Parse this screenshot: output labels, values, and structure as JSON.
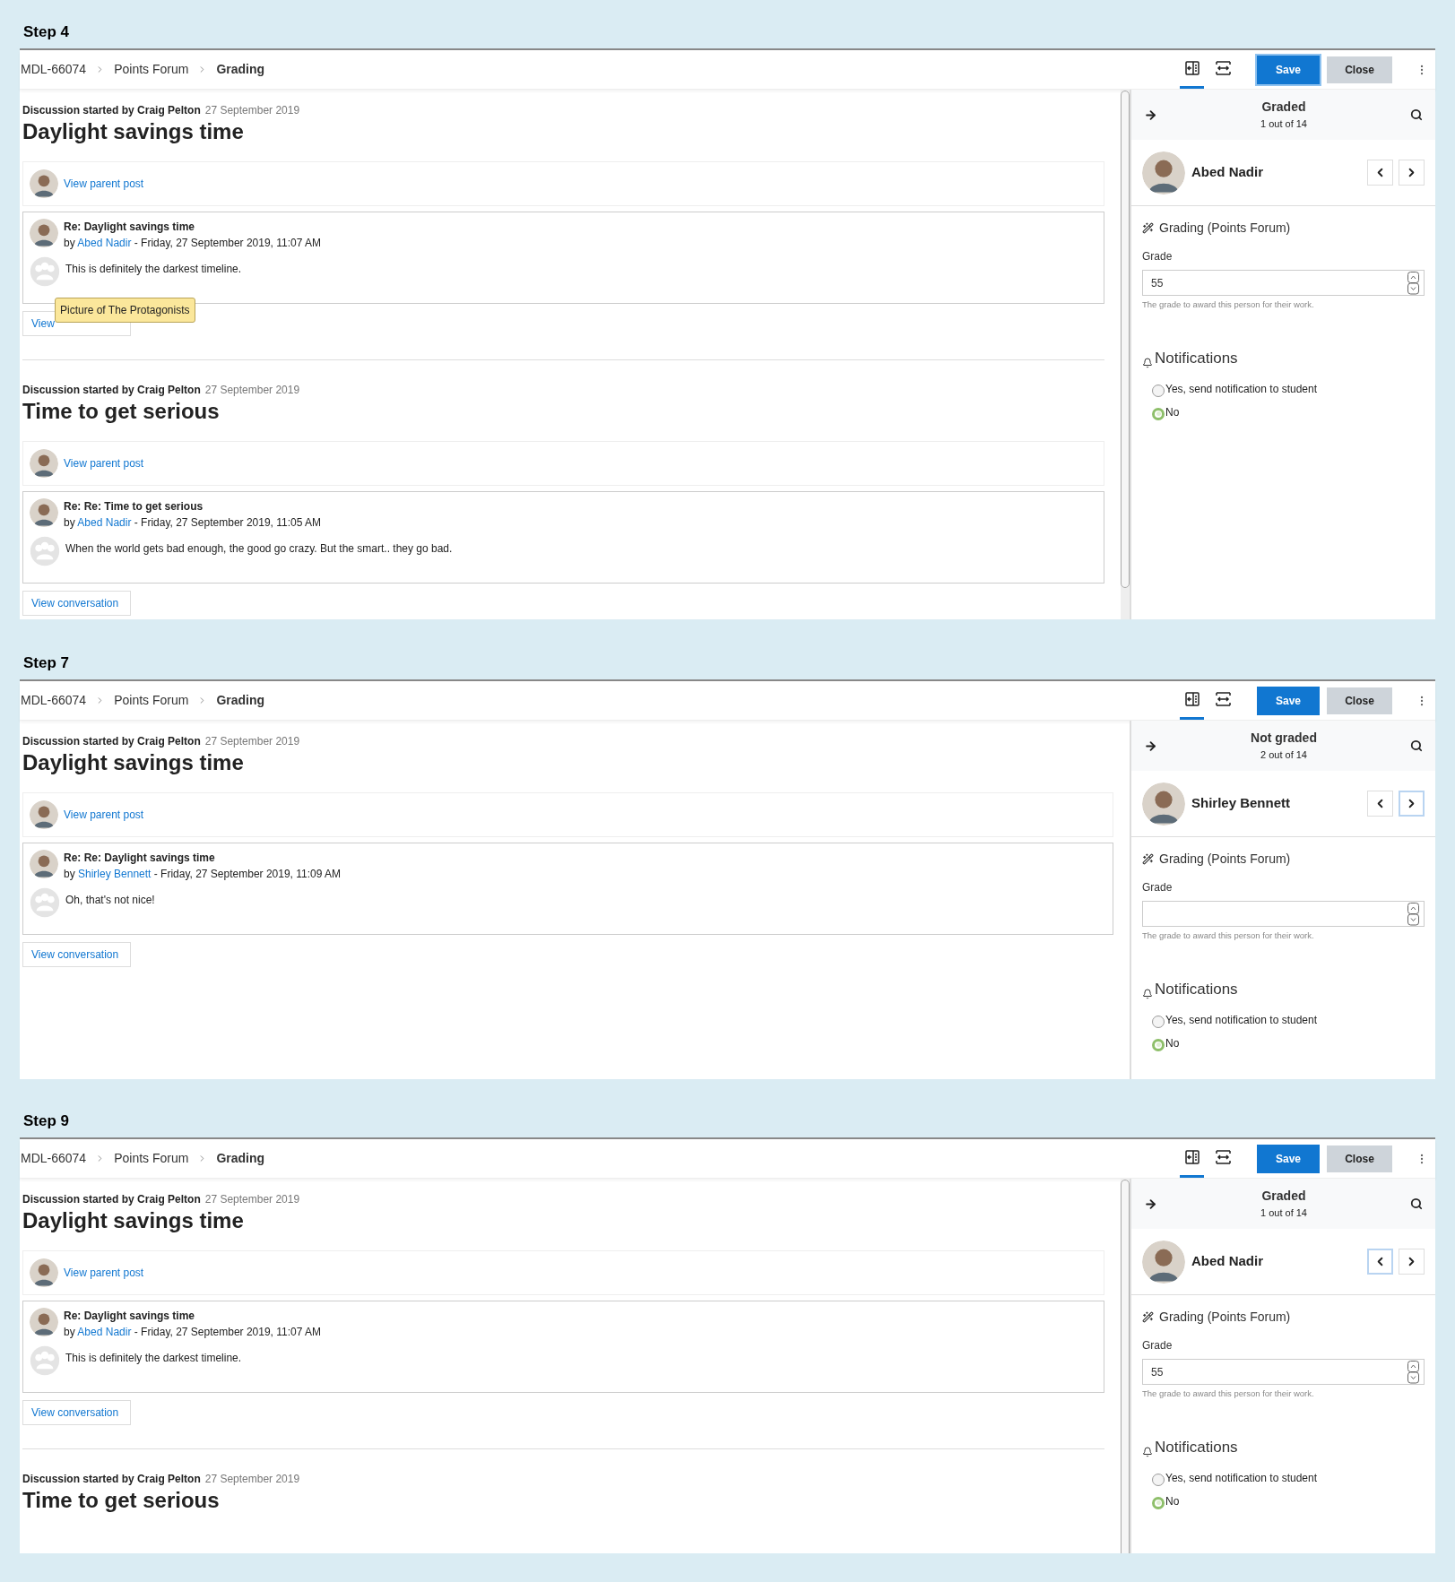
{
  "steps": [
    {
      "label": "Step 4",
      "breadcrumb": [
        {
          "label": "MDL-66074",
          "current": false
        },
        {
          "label": "Points Forum",
          "current": false
        },
        {
          "label": "Grading",
          "current": true
        }
      ],
      "toolbar": {
        "tabs": [
          {
            "kind": "collapse",
            "selected": true
          },
          {
            "kind": "expand",
            "selected": false
          }
        ],
        "save": {
          "label": "Save",
          "focused": true
        },
        "close": "Close"
      },
      "scrollable": true,
      "discussions": [
        {
          "started_by": "Discussion started by Craig Pelton",
          "date": "27 September 2019",
          "title": "Daylight savings time",
          "parent_link": "View parent post",
          "post": {
            "subject": "Re: Daylight savings time",
            "by": "by",
            "author": "Abed Nadir",
            "time": "- Friday, 27 September 2019, 11:07 AM",
            "message": "This is definitely the darkest timeline."
          },
          "view_conversation": "View",
          "tooltip": "Picture of The Protagonists"
        },
        {
          "started_by": "Discussion started by Craig Pelton",
          "date": "27 September 2019",
          "title": "Time to get serious",
          "parent_link": "View parent post",
          "post": {
            "subject": "Re: Re: Time to get serious",
            "by": "by",
            "author": "Abed Nadir",
            "time": "- Friday, 27 September 2019, 11:05 AM",
            "message": "When the world gets bad enough, the good go crazy. But the smart.. they go bad."
          },
          "view_conversation": "View conversation"
        }
      ],
      "grader": {
        "status": "Graded",
        "position": "1 out of 14",
        "student": "Abed Nadir",
        "nav": [
          {
            "kind": "prev",
            "focused": false
          },
          {
            "kind": "next",
            "focused": false
          }
        ],
        "section": "Grading (Points Forum)",
        "grade_label": "Grade",
        "grade_value": "55",
        "grade_help": "The grade to award this person for their work.",
        "notifications": "Notifications",
        "options": [
          {
            "label": "Yes, send notification to student",
            "selected": false
          },
          {
            "label": "No",
            "selected": true
          }
        ]
      }
    },
    {
      "label": "Step 7",
      "breadcrumb": [
        {
          "label": "MDL-66074",
          "current": false
        },
        {
          "label": "Points Forum",
          "current": false
        },
        {
          "label": "Grading",
          "current": true
        }
      ],
      "toolbar": {
        "tabs": [
          {
            "kind": "collapse",
            "selected": true
          },
          {
            "kind": "expand",
            "selected": false
          }
        ],
        "save": {
          "label": "Save",
          "focused": false
        },
        "close": "Close"
      },
      "discussions": [
        {
          "started_by": "Discussion started by Craig Pelton",
          "date": "27 September 2019",
          "title": "Daylight savings time",
          "parent_link": "View parent post",
          "post": {
            "subject": "Re: Re: Daylight savings time",
            "by": "by",
            "author": "Shirley Bennett",
            "time": "- Friday, 27 September 2019, 11:09 AM",
            "message": "Oh, that's not nice!"
          },
          "view_conversation": "View conversation"
        }
      ],
      "grader": {
        "status": "Not graded",
        "position": "2 out of 14",
        "student": "Shirley Bennett",
        "nav": [
          {
            "kind": "prev",
            "focused": false
          },
          {
            "kind": "next",
            "focused": true
          }
        ],
        "section": "Grading (Points Forum)",
        "grade_label": "Grade",
        "grade_help": "The grade to award this person for their work.",
        "notifications": "Notifications",
        "options": [
          {
            "label": "Yes, send notification to student",
            "selected": false
          },
          {
            "label": "No",
            "selected": true
          }
        ]
      }
    },
    {
      "label": "Step 9",
      "breadcrumb": [
        {
          "label": "MDL-66074",
          "current": false
        },
        {
          "label": "Points Forum",
          "current": false
        },
        {
          "label": "Grading",
          "current": true
        }
      ],
      "toolbar": {
        "tabs": [
          {
            "kind": "collapse",
            "selected": true
          },
          {
            "kind": "expand",
            "selected": false
          }
        ],
        "save": {
          "label": "Save",
          "focused": false
        },
        "close": "Close"
      },
      "scrollable": true,
      "discussions": [
        {
          "started_by": "Discussion started by Craig Pelton",
          "date": "27 September 2019",
          "title": "Daylight savings time",
          "parent_link": "View parent post",
          "post": {
            "subject": "Re: Daylight savings time",
            "by": "by",
            "author": "Abed Nadir",
            "time": "- Friday, 27 September 2019, 11:07 AM",
            "message": "This is definitely the darkest timeline."
          },
          "view_conversation": "View conversation"
        },
        {
          "started_by": "Discussion started by Craig Pelton",
          "date": "27 September 2019",
          "title": "Time to get serious"
        }
      ],
      "grader": {
        "status": "Graded",
        "position": "1 out of 14",
        "student": "Abed Nadir",
        "nav": [
          {
            "kind": "prev",
            "focused": true
          },
          {
            "kind": "next",
            "focused": false
          }
        ],
        "section": "Grading (Points Forum)",
        "grade_label": "Grade",
        "grade_value": "55",
        "grade_help": "The grade to award this person for their work.",
        "notifications": "Notifications",
        "options": [
          {
            "label": "Yes, send notification to student",
            "selected": false
          },
          {
            "label": "No",
            "selected": true
          }
        ]
      }
    }
  ]
}
